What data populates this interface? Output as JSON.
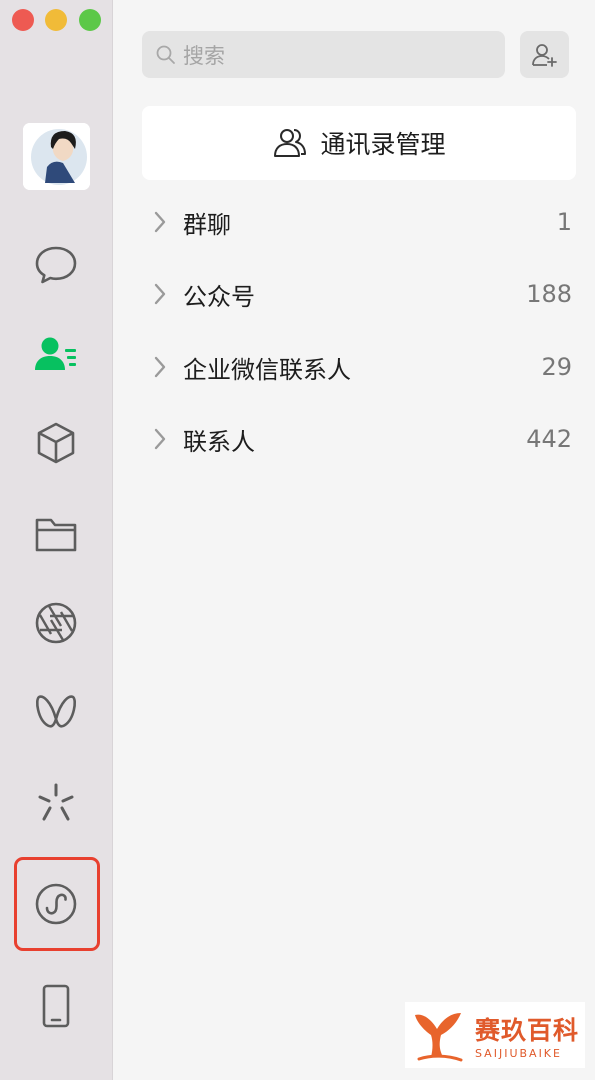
{
  "search": {
    "placeholder": "搜索"
  },
  "manage_button": {
    "label": "通讯录管理"
  },
  "contact_groups": [
    {
      "label": "群聊",
      "count": "1"
    },
    {
      "label": "公众号",
      "count": "188"
    },
    {
      "label": "企业微信联系人",
      "count": "29"
    },
    {
      "label": "联系人",
      "count": "442"
    }
  ],
  "sidebar": {
    "icons": [
      "chat-icon",
      "contacts-icon",
      "cube-icon",
      "folder-icon",
      "aperture-icon",
      "butterfly-icon",
      "sparkle-icon",
      "mini-program-icon",
      "phone-icon"
    ],
    "active": "contacts-icon",
    "highlighted": "mini-program-icon"
  },
  "watermark": {
    "cn": "赛玖百科",
    "en": "SAIJIUBAIKE"
  },
  "colors": {
    "accent": "#07c160",
    "highlight": "#e8402f",
    "sidebar_bg": "#e5e1e4"
  }
}
